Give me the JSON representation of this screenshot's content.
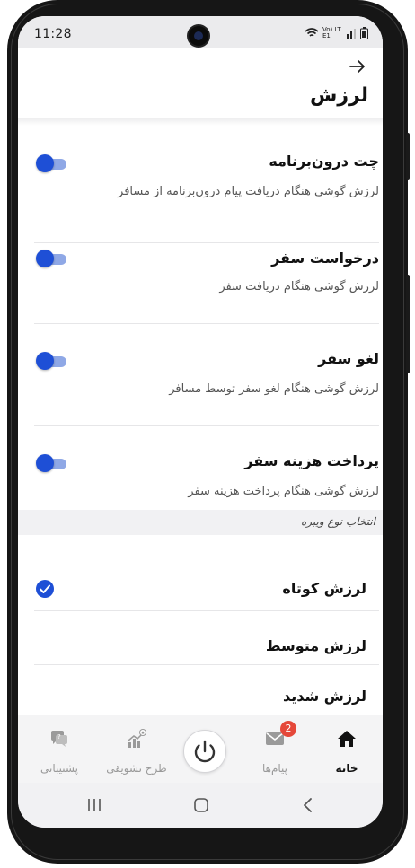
{
  "status_bar": {
    "time": "11:28",
    "network_label": "Vo) LTE1"
  },
  "header": {
    "title": "لرزش"
  },
  "settings": [
    {
      "title": "چت درون‌برنامه",
      "description": "لرزش گوشی هنگام دریافت پیام درون‌برنامه از مسافر",
      "enabled": true
    },
    {
      "title": "درخواست سفر",
      "description": "لرزش گوشی هنگام دریافت سفر",
      "enabled": true
    },
    {
      "title": "لغو سفر",
      "description": "لرزش گوشی هنگام لغو سفر توسط مسافر",
      "enabled": true
    },
    {
      "title": "پرداخت هزینه سفر",
      "description": "لرزش گوشی هنگام پرداخت هزینه سفر",
      "enabled": true
    }
  ],
  "vibration_type": {
    "section_label": "انتخاب نوع ویبره",
    "options": [
      {
        "label": "لرزش کوتاه",
        "selected": true
      },
      {
        "label": "لرزش متوسط",
        "selected": false
      },
      {
        "label": "لرزش شدید",
        "selected": false
      }
    ]
  },
  "bottom_nav": {
    "home": "خانه",
    "messages": "پیام‌ها",
    "messages_badge": "2",
    "incentive": "طرح تشویقی",
    "support": "پشتیبانی"
  },
  "colors": {
    "accent": "#1e4fd6",
    "badge": "#e5483a"
  }
}
